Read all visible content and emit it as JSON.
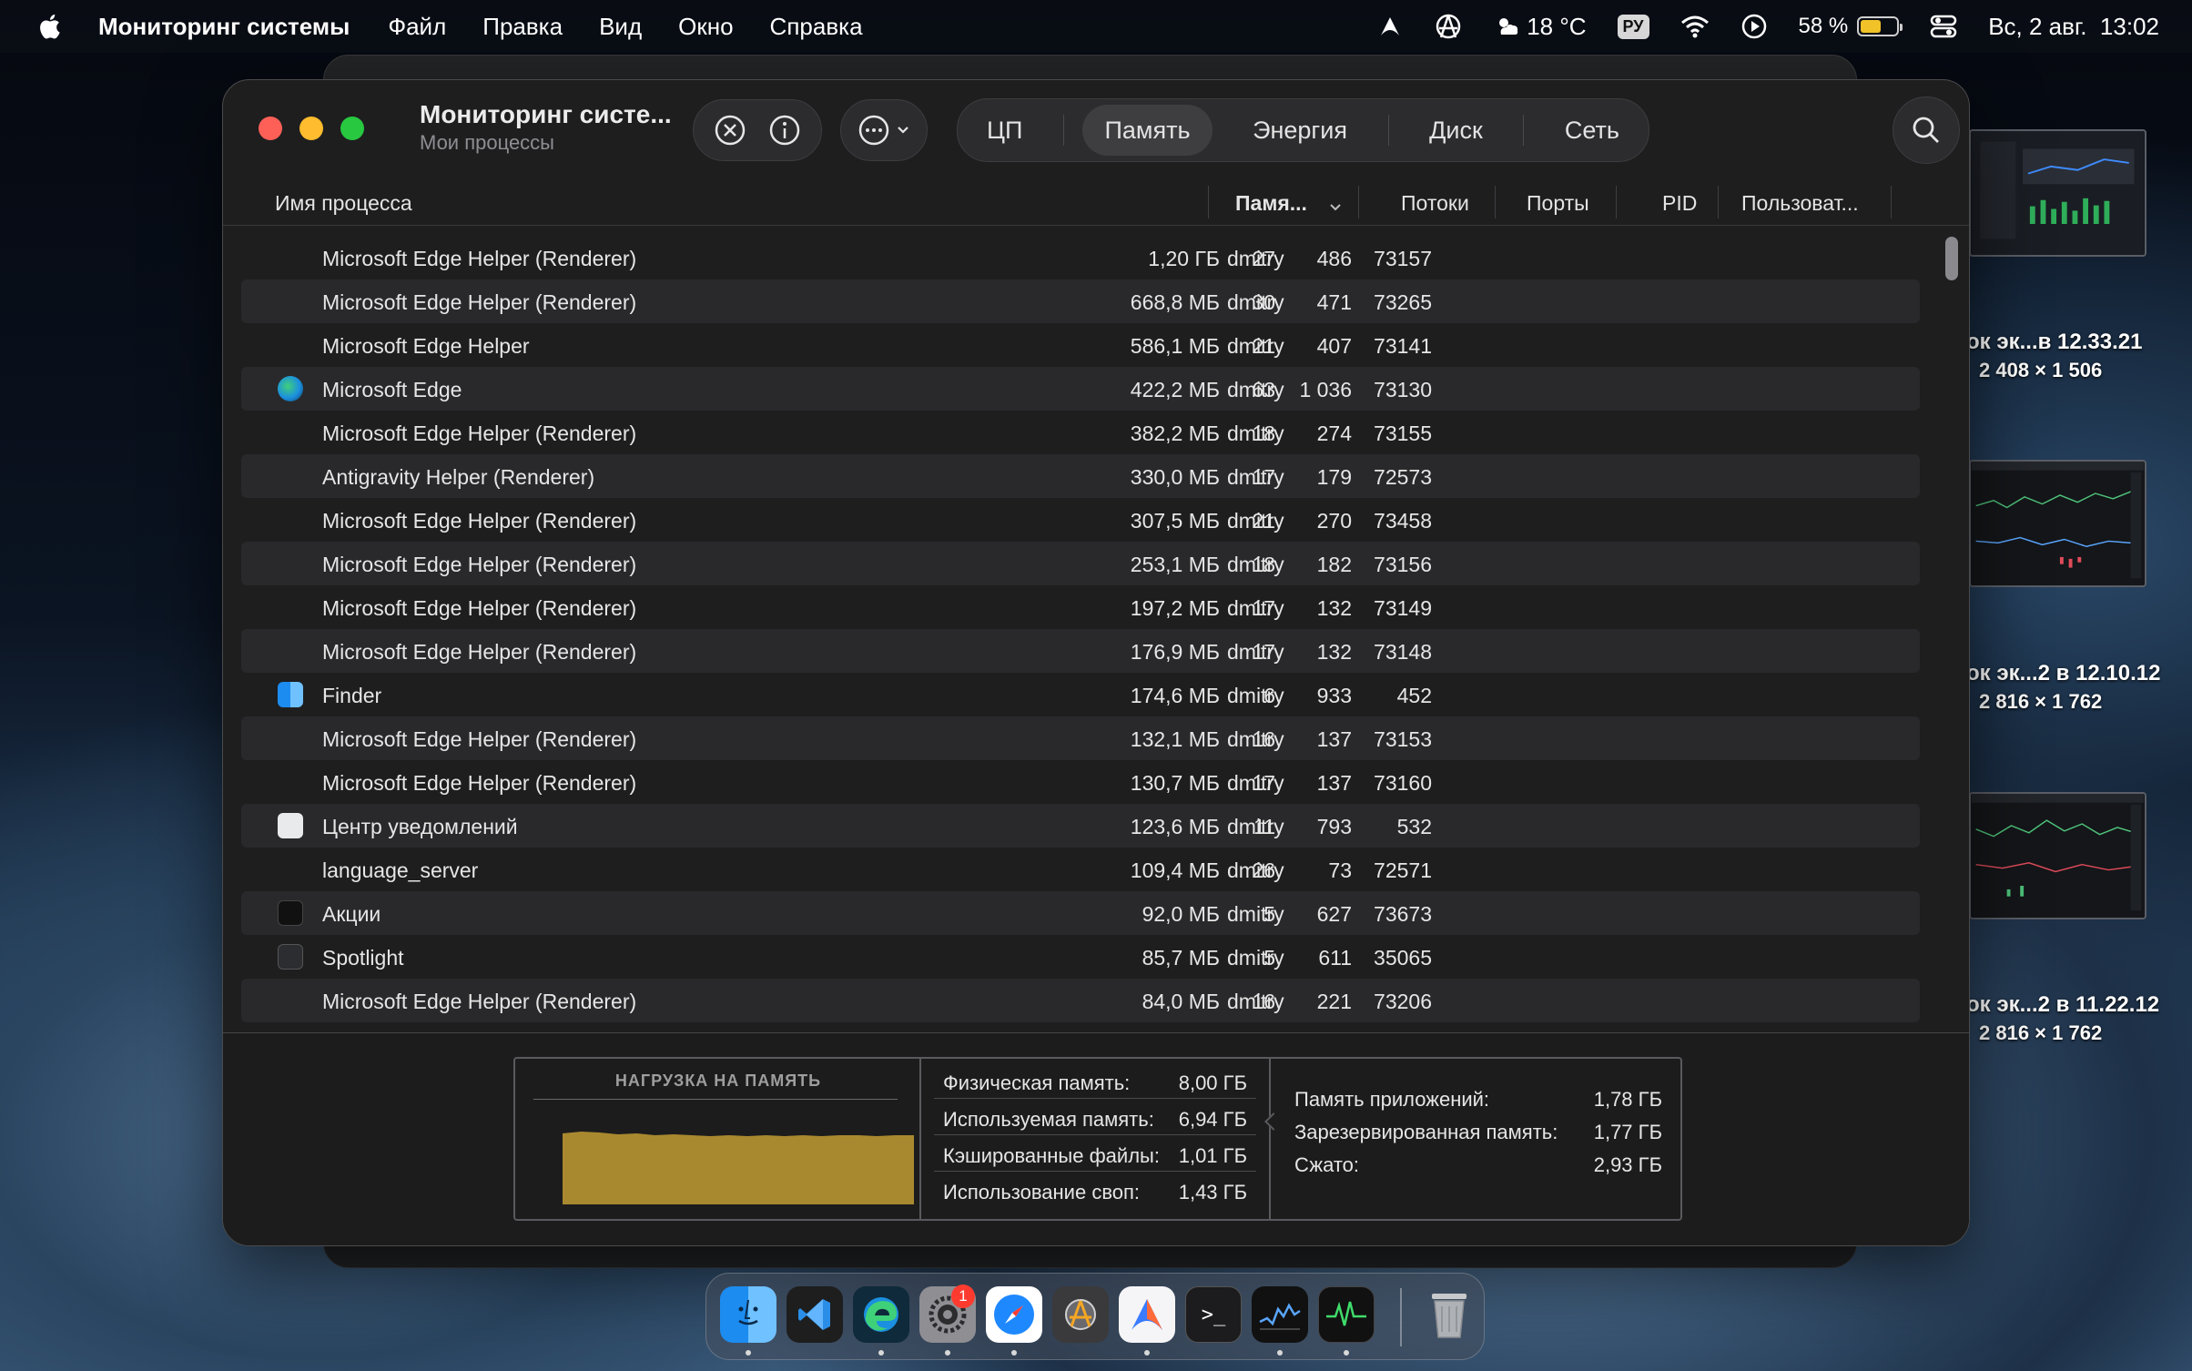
{
  "menubar": {
    "app_name": "Мониторинг системы",
    "items": [
      "Файл",
      "Правка",
      "Вид",
      "Окно",
      "Справка"
    ],
    "weather": "18 °C",
    "keyboard": "РУ",
    "battery_percent_text": "58 %",
    "battery_level": 0.58,
    "datetime": "Вс, 2 авг.  13:02"
  },
  "desktop": {
    "files": [
      {
        "name": "ок эк...в 12.33.21",
        "size": "2 408 × 1 506"
      },
      {
        "name": "ок эк...2 в 12.10.12",
        "size": "2 816 × 1 762"
      },
      {
        "name": "ок эк...2 в 11.22.12",
        "size": "2 816 × 1 762"
      }
    ]
  },
  "window": {
    "title": "Мониторинг систе...",
    "subtitle": "Мои процессы",
    "tabs": [
      "ЦП",
      "Память",
      "Энергия",
      "Диск",
      "Сеть"
    ],
    "active_tab": "Память",
    "columns": {
      "name": "Имя процесса",
      "memory": "Памя...",
      "threads": "Потоки",
      "ports": "Порты",
      "pid": "PID",
      "user": "Пользоват..."
    },
    "rows": [
      {
        "name": "Microsoft Edge Helper (Renderer)",
        "mem": "1,20 ГБ",
        "threads": "27",
        "ports": "486",
        "pid": "73157",
        "user": "dmitry",
        "icon": ""
      },
      {
        "name": "Microsoft Edge Helper (Renderer)",
        "mem": "668,8 МБ",
        "threads": "30",
        "ports": "471",
        "pid": "73265",
        "user": "dmitry",
        "icon": ""
      },
      {
        "name": "Microsoft Edge Helper",
        "mem": "586,1 МБ",
        "threads": "21",
        "ports": "407",
        "pid": "73141",
        "user": "dmitry",
        "icon": ""
      },
      {
        "name": "Microsoft Edge",
        "mem": "422,2 МБ",
        "threads": "63",
        "ports": "1 036",
        "pid": "73130",
        "user": "dmitry",
        "icon": "edge"
      },
      {
        "name": "Microsoft Edge Helper (Renderer)",
        "mem": "382,2 МБ",
        "threads": "18",
        "ports": "274",
        "pid": "73155",
        "user": "dmitry",
        "icon": ""
      },
      {
        "name": "Antigravity Helper (Renderer)",
        "mem": "330,0 МБ",
        "threads": "17",
        "ports": "179",
        "pid": "72573",
        "user": "dmitry",
        "icon": ""
      },
      {
        "name": "Microsoft Edge Helper (Renderer)",
        "mem": "307,5 МБ",
        "threads": "21",
        "ports": "270",
        "pid": "73458",
        "user": "dmitry",
        "icon": ""
      },
      {
        "name": "Microsoft Edge Helper (Renderer)",
        "mem": "253,1 МБ",
        "threads": "18",
        "ports": "182",
        "pid": "73156",
        "user": "dmitry",
        "icon": ""
      },
      {
        "name": "Microsoft Edge Helper (Renderer)",
        "mem": "197,2 МБ",
        "threads": "17",
        "ports": "132",
        "pid": "73149",
        "user": "dmitry",
        "icon": ""
      },
      {
        "name": "Microsoft Edge Helper (Renderer)",
        "mem": "176,9 МБ",
        "threads": "17",
        "ports": "132",
        "pid": "73148",
        "user": "dmitry",
        "icon": ""
      },
      {
        "name": "Finder",
        "mem": "174,6 МБ",
        "threads": "6",
        "ports": "933",
        "pid": "452",
        "user": "dmitry",
        "icon": "finder"
      },
      {
        "name": "Microsoft Edge Helper (Renderer)",
        "mem": "132,1 МБ",
        "threads": "16",
        "ports": "137",
        "pid": "73153",
        "user": "dmitry",
        "icon": ""
      },
      {
        "name": "Microsoft Edge Helper (Renderer)",
        "mem": "130,7 МБ",
        "threads": "17",
        "ports": "137",
        "pid": "73160",
        "user": "dmitry",
        "icon": ""
      },
      {
        "name": "Центр уведомлений",
        "mem": "123,6 МБ",
        "threads": "11",
        "ports": "793",
        "pid": "532",
        "user": "dmitry",
        "icon": "notification"
      },
      {
        "name": "language_server",
        "mem": "109,4 МБ",
        "threads": "26",
        "ports": "73",
        "pid": "72571",
        "user": "dmitry",
        "icon": ""
      },
      {
        "name": "Акции",
        "mem": "92,0 МБ",
        "threads": "5",
        "ports": "627",
        "pid": "73673",
        "user": "dmitry",
        "icon": "stocks"
      },
      {
        "name": "Spotlight",
        "mem": "85,7 МБ",
        "threads": "5",
        "ports": "611",
        "pid": "35065",
        "user": "dmitry",
        "icon": "spotlight"
      },
      {
        "name": "Microsoft Edge Helper (Renderer)",
        "mem": "84,0 МБ",
        "threads": "16",
        "ports": "221",
        "pid": "73206",
        "user": "dmitry",
        "icon": ""
      }
    ]
  },
  "memory_panel": {
    "pressure_title": "НАГРУЗКА НА ПАМЯТЬ",
    "pressure_levels": [
      0.78,
      0.8,
      0.79,
      0.77,
      0.78,
      0.76,
      0.77,
      0.76,
      0.75,
      0.76,
      0.75,
      0.76,
      0.75,
      0.76,
      0.75,
      0.76,
      0.76,
      0.75,
      0.76,
      0.76
    ],
    "physical": [
      {
        "label": "Физическая память:",
        "value": "8,00 ГБ"
      },
      {
        "label": "Используемая память:",
        "value": "6,94 ГБ"
      },
      {
        "label": "Кэшированные файлы:",
        "value": "1,01 ГБ"
      },
      {
        "label": "Использование своп:",
        "value": "1,43 ГБ"
      }
    ],
    "breakdown": [
      {
        "label": "Память приложений:",
        "value": "1,78 ГБ"
      },
      {
        "label": "Зарезервированная память:",
        "value": "1,77 ГБ"
      },
      {
        "label": "Сжато:",
        "value": "2,93 ГБ"
      }
    ]
  },
  "dock": {
    "apps": [
      "finder-icon",
      "vscode-icon",
      "edge-icon",
      "system-settings-icon",
      "safari-icon",
      "instruments-icon",
      "antigravity-icon",
      "terminal-icon",
      "stocks-icon",
      "activity-monitor-icon"
    ],
    "settings_badge": "1"
  },
  "colors": {
    "accent_pressure": "#a9892f",
    "traffic_red": "#fe5f57",
    "traffic_yellow": "#febc2e",
    "traffic_green": "#28c840"
  }
}
